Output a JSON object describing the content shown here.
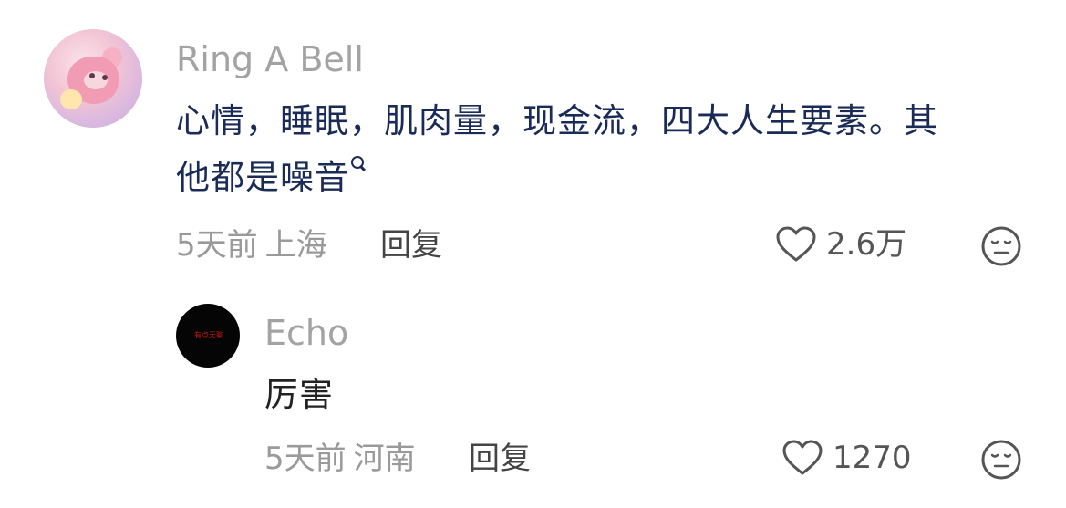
{
  "comments": [
    {
      "username": "Ring A Bell",
      "text_line1": "心情，睡眠，肌肉量，现金流，四大人生要素。其",
      "text_line2": "他都是噪音",
      "time": "5天前",
      "location": "上海",
      "reply_label": "回复",
      "likes": "2.6万",
      "avatar_icon": "pink-plush-toy-avatar"
    },
    {
      "username": "Echo",
      "text": "厉害",
      "time": "5天前",
      "location": "河南",
      "reply_label": "回复",
      "likes": "1270",
      "avatar_icon": "black-avatar-red-text",
      "avatar_text": "有点无聊"
    }
  ],
  "colors": {
    "username": "#a3a3a3",
    "main_text": "#1a2b57",
    "reply_text": "#222222",
    "meta": "#9a9a9a"
  },
  "icons": {
    "like": "heart-outline-icon",
    "emoji": "expressionless-face-icon",
    "search": "search-magnifier-icon"
  }
}
